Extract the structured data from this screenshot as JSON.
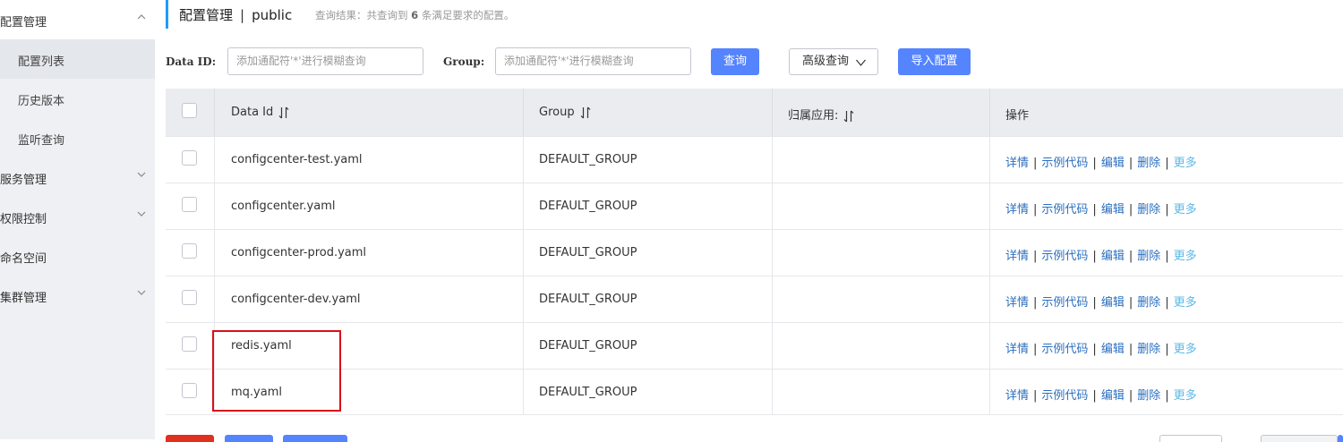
{
  "sidebar": {
    "config_group": "配置管理",
    "sub_items": [
      "配置列表",
      "历史版本",
      "监听查询"
    ],
    "service_group": "服务管理",
    "auth_group": "权限控制",
    "namespace_group": "命名空间",
    "cluster_group": "集群管理"
  },
  "header": {
    "title": "配置管理",
    "separator": "|",
    "namespace": "public",
    "result_prefix": "查询结果：共查询到",
    "result_count": "6",
    "result_suffix": "条满足要求的配置。"
  },
  "search": {
    "data_id_label": "Data ID:",
    "data_id_placeholder": "添加通配符'*'进行模糊查询",
    "group_label": "Group:",
    "group_placeholder": "添加通配符'*'进行模糊查询",
    "query_button": "查询",
    "advanced_button": "高级查询",
    "import_button": "导入配置"
  },
  "table": {
    "headers": {
      "data_id": "Data Id",
      "group": "Group",
      "app": "归属应用:",
      "ops": "操作"
    },
    "rows": [
      {
        "data_id": "configcenter-test.yaml",
        "group": "DEFAULT_GROUP",
        "app": ""
      },
      {
        "data_id": "configcenter.yaml",
        "group": "DEFAULT_GROUP",
        "app": ""
      },
      {
        "data_id": "configcenter-prod.yaml",
        "group": "DEFAULT_GROUP",
        "app": ""
      },
      {
        "data_id": "configcenter-dev.yaml",
        "group": "DEFAULT_GROUP",
        "app": ""
      },
      {
        "data_id": "redis.yaml",
        "group": "DEFAULT_GROUP",
        "app": ""
      },
      {
        "data_id": "mq.yaml",
        "group": "DEFAULT_GROUP",
        "app": ""
      }
    ],
    "ops": {
      "details": "详情",
      "sample_code": "示例代码",
      "edit": "编辑",
      "delete": "删除",
      "more": "更多",
      "pipe": "|"
    }
  },
  "colors": {
    "primary": "#5584ff",
    "accent_bar": "#209bfa",
    "link": "#2a6fbf",
    "more_link": "#5bb8e6",
    "highlight": "#d9101a",
    "danger": "#e0301e"
  },
  "icons": {
    "sort": "sort-icon",
    "chevron": "chevron-down-icon"
  }
}
